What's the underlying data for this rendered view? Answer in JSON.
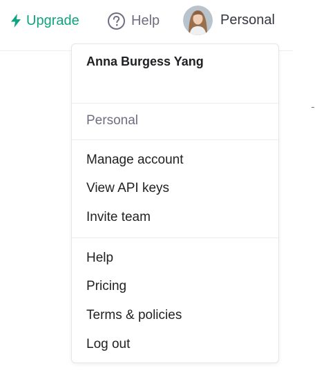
{
  "topbar": {
    "upgrade_label": "Upgrade",
    "upgrade_icon": "bolt-icon",
    "help_label": "Help",
    "help_icon": "question-circle-icon",
    "account_label": "Personal"
  },
  "menu": {
    "user_name": "Anna Burgess Yang",
    "organization": "Personal",
    "account_items": [
      {
        "label": "Manage account"
      },
      {
        "label": "View API keys"
      },
      {
        "label": "Invite team"
      }
    ],
    "general_items": [
      {
        "label": "Help"
      },
      {
        "label": "Pricing"
      },
      {
        "label": "Terms & policies"
      },
      {
        "label": "Log out"
      }
    ]
  },
  "colors": {
    "accent": "#10a37f",
    "text": "#202123",
    "muted": "#6e6e80",
    "divider": "#ececf1"
  }
}
